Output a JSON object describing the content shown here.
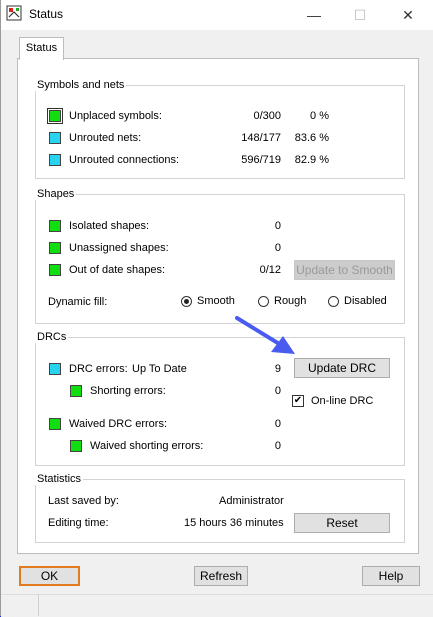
{
  "window": {
    "title": "Status",
    "minimize_glyph": "—",
    "maximize_glyph": "☐",
    "close_glyph": "✕"
  },
  "tab": {
    "label": "Status"
  },
  "symbols": {
    "heading": "Symbols and nets",
    "rows": [
      {
        "label": "Unplaced symbols:",
        "count": "0/300",
        "percent": "0 %",
        "color": "#11dd11"
      },
      {
        "label": "Unrouted nets:",
        "count": "148/177",
        "percent": "83.6 %",
        "color": "#27d3ee"
      },
      {
        "label": "Unrouted connections:",
        "count": "596/719",
        "percent": "82.9 %",
        "color": "#27d3ee"
      }
    ]
  },
  "shapes": {
    "heading": "Shapes",
    "rows": [
      {
        "label": "Isolated shapes:",
        "count": "0"
      },
      {
        "label": "Unassigned shapes:",
        "count": "0"
      },
      {
        "label": "Out of date shapes:",
        "count": "0/12"
      }
    ],
    "update_button": "Update to Smooth",
    "dynamic_fill_label": "Dynamic fill:",
    "fill_options": [
      "Smooth",
      "Rough",
      "Disabled"
    ],
    "fill_selected": "Smooth"
  },
  "drcs": {
    "heading": "DRCs",
    "drc_errors_label": "DRC errors:",
    "drc_state": "Up To Date",
    "drc_errors_count": "9",
    "shorting_label": "Shorting errors:",
    "shorting_count": "0",
    "waived_label": "Waived DRC errors:",
    "waived_count": "0",
    "waived_shorting_label": "Waived shorting errors:",
    "waived_shorting_count": "0",
    "update_button": "Update DRC",
    "online_label": "On-line DRC",
    "online_checked": true
  },
  "statistics": {
    "heading": "Statistics",
    "last_saved_label": "Last saved by:",
    "last_saved_value": "Administrator",
    "editing_label": "Editing time:",
    "editing_value": "15 hours 36 minutes",
    "reset_button": "Reset"
  },
  "footer": {
    "ok": "OK",
    "refresh": "Refresh",
    "help": "Help"
  },
  "annotation": {
    "arrow_color": "#4a5cf0"
  }
}
